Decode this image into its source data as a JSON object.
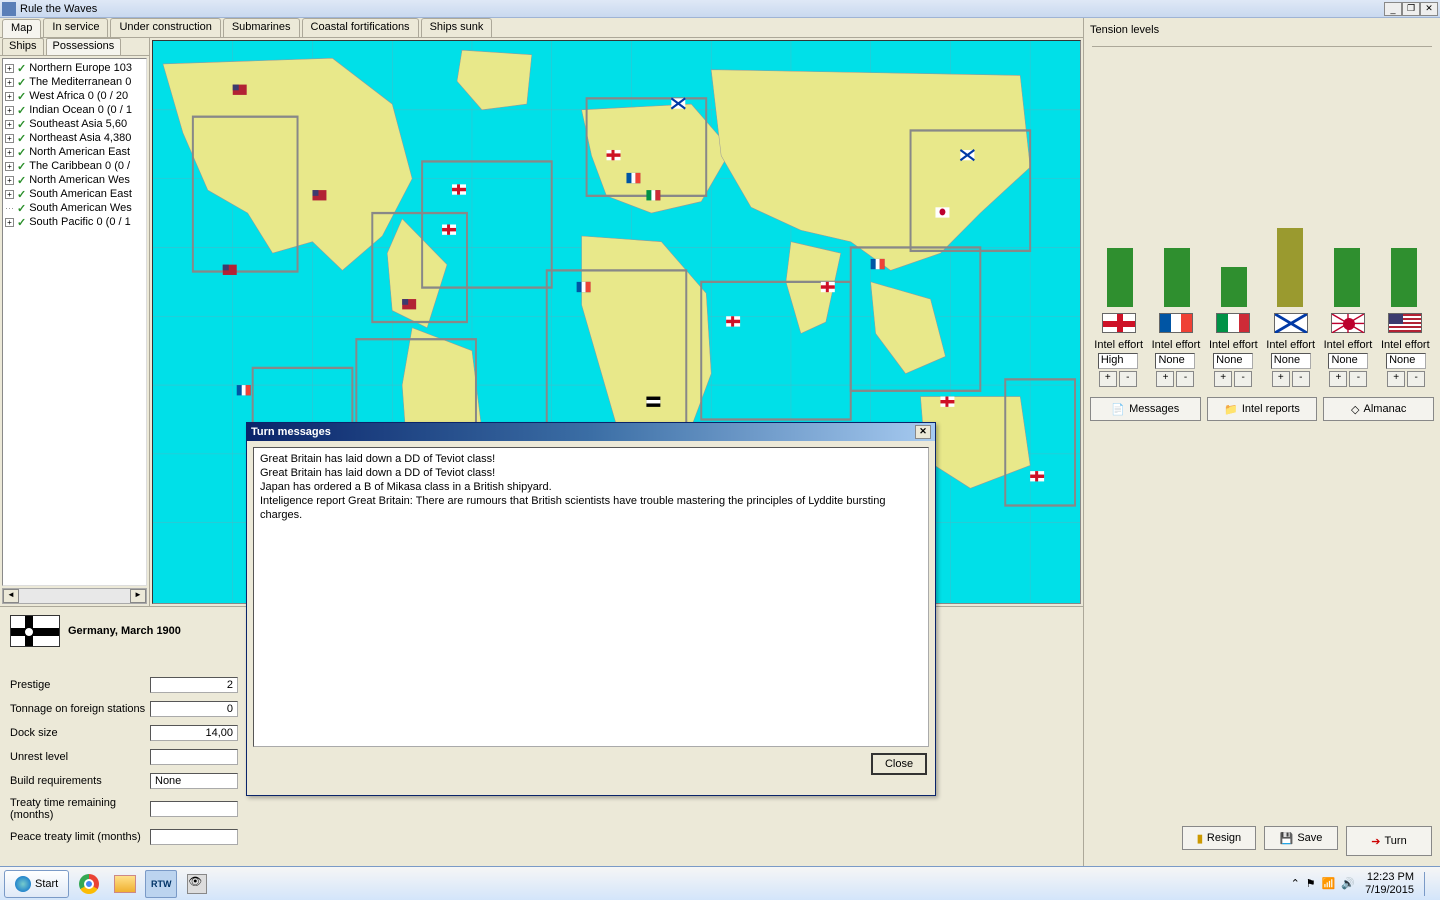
{
  "titlebar": {
    "title": "Rule the Waves"
  },
  "tabs": [
    "Map",
    "In service",
    "Under construction",
    "Submarines",
    "Coastal fortifications",
    "Ships sunk"
  ],
  "sub_tabs": [
    "Ships",
    "Possessions"
  ],
  "tree": [
    {
      "exp": "+",
      "label": "Northern Europe 103"
    },
    {
      "exp": "+",
      "label": "The Mediterranean 0"
    },
    {
      "exp": "+",
      "label": "West Africa 0 (0 / 20"
    },
    {
      "exp": "+",
      "label": "Indian Ocean 0 (0 / 1"
    },
    {
      "exp": "+",
      "label": "Southeast Asia 5,60"
    },
    {
      "exp": "+",
      "label": "Northeast Asia 4,380"
    },
    {
      "exp": "+",
      "label": "North American East"
    },
    {
      "exp": "+",
      "label": "The Caribbean 0 (0 /"
    },
    {
      "exp": "+",
      "label": "North American Wes"
    },
    {
      "exp": "+",
      "label": "South American East"
    },
    {
      "exp": "",
      "label": "South American Wes"
    },
    {
      "exp": "+",
      "label": "South Pacific 0 (0 / 1"
    }
  ],
  "nation": {
    "name": "Germany, March 1900"
  },
  "stats": {
    "prestige_label": "Prestige",
    "prestige_val": "2",
    "tonnage_label": "Tonnage on foreign stations",
    "tonnage_val": "0",
    "dock_label": "Dock size",
    "dock_val": "14,00",
    "unrest_label": "Unrest level",
    "unrest_val": "",
    "build_label": "Build requirements",
    "build_val": "None",
    "treaty_label": "Treaty time remaining (months)",
    "treaty_val": "",
    "peace_label": "Peace treaty limit (months)",
    "peace_val": ""
  },
  "right": {
    "title": "Tension levels",
    "intel_label": "Intel effort",
    "messages_btn": "Messages",
    "intel_btn": "Intel reports",
    "almanac_btn": "Almanac",
    "resign_btn": "Resign",
    "save_btn": "Save",
    "turn_btn": "Turn"
  },
  "chart_data": {
    "type": "bar",
    "categories": [
      "Britain",
      "France",
      "Italy",
      "Russia",
      "Japan",
      "USA"
    ],
    "values": [
      27,
      27,
      18,
      36,
      27,
      27
    ],
    "colors": [
      "#2f8f2f",
      "#2f8f2f",
      "#2f8f2f",
      "#9a9a2f",
      "#2f8f2f",
      "#2f8f2f"
    ],
    "series_flags": [
      "uk",
      "france",
      "italy",
      "russia",
      "japan",
      "usa"
    ],
    "ylim": [
      0,
      100
    ]
  },
  "intel_efforts": [
    "High",
    "None",
    "None",
    "None",
    "None",
    "None"
  ],
  "dialog": {
    "title": "Turn messages",
    "lines": [
      "Great Britain has laid down a DD of Teviot class!",
      "Great Britain has laid down a DD of Teviot class!",
      "Japan has ordered a B of Mikasa class in a British shipyard.",
      "Inteligence report Great Britain:  There are rumours that British scientists have trouble mastering the principles of Lyddite bursting charges."
    ],
    "close": "Close"
  },
  "taskbar": {
    "start": "Start",
    "time": "12:23 PM",
    "date": "7/19/2015"
  }
}
